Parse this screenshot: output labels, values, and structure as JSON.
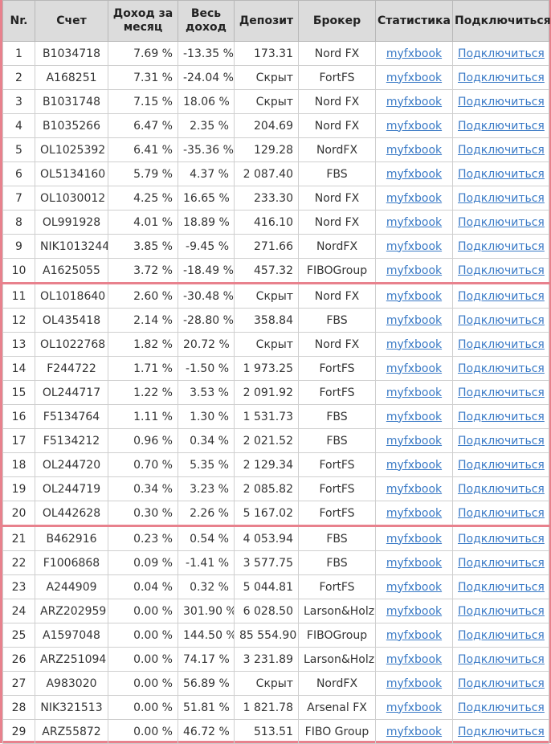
{
  "table": {
    "headers": [
      "Nr.",
      "Счет",
      "Доход за месяц",
      "Весь доход",
      "Депозит",
      "Брокер",
      "Статистика",
      "Подключиться"
    ],
    "stats_link_label": "myfxbook",
    "connect_link_label": "Подключиться",
    "rows": [
      {
        "nr": "1",
        "account": "B1034718",
        "monthly": "7.69 %",
        "total": "-13.35 %",
        "deposit": "173.31",
        "broker": "Nord FX"
      },
      {
        "nr": "2",
        "account": "A168251",
        "monthly": "7.31 %",
        "total": "-24.04 %",
        "deposit": "Скрыт",
        "broker": "FortFS"
      },
      {
        "nr": "3",
        "account": "B1031748",
        "monthly": "7.15 %",
        "total": "18.06 %",
        "deposit": "Скрыт",
        "broker": "Nord FX"
      },
      {
        "nr": "4",
        "account": "B1035266",
        "monthly": "6.47 %",
        "total": "2.35 %",
        "deposit": "204.69",
        "broker": "Nord FX"
      },
      {
        "nr": "5",
        "account": "OL1025392",
        "monthly": "6.41 %",
        "total": "-35.36 %",
        "deposit": "129.28",
        "broker": "NordFX"
      },
      {
        "nr": "6",
        "account": "OL5134160",
        "monthly": "5.79 %",
        "total": "4.37 %",
        "deposit": "2 087.40",
        "broker": "FBS"
      },
      {
        "nr": "7",
        "account": "OL1030012",
        "monthly": "4.25 %",
        "total": "16.65 %",
        "deposit": "233.30",
        "broker": "Nord FX"
      },
      {
        "nr": "8",
        "account": "OL991928",
        "monthly": "4.01 %",
        "total": "18.89 %",
        "deposit": "416.10",
        "broker": "Nord FX"
      },
      {
        "nr": "9",
        "account": "NIK1013244",
        "monthly": "3.85 %",
        "total": "-9.45 %",
        "deposit": "271.66",
        "broker": "NordFX"
      },
      {
        "nr": "10",
        "account": "A1625055",
        "monthly": "3.72 %",
        "total": "-18.49 %",
        "deposit": "457.32",
        "broker": "FIBOGroup"
      },
      {
        "nr": "11",
        "account": "OL1018640",
        "monthly": "2.60 %",
        "total": "-30.48 %",
        "deposit": "Скрыт",
        "broker": "Nord FX"
      },
      {
        "nr": "12",
        "account": "OL435418",
        "monthly": "2.14 %",
        "total": "-28.80 %",
        "deposit": "358.84",
        "broker": "FBS"
      },
      {
        "nr": "13",
        "account": "OL1022768",
        "monthly": "1.82 %",
        "total": "20.72 %",
        "deposit": "Скрыт",
        "broker": "Nord FX"
      },
      {
        "nr": "14",
        "account": "F244722",
        "monthly": "1.71 %",
        "total": "-1.50 %",
        "deposit": "1 973.25",
        "broker": "FortFS"
      },
      {
        "nr": "15",
        "account": "OL244717",
        "monthly": "1.22 %",
        "total": "3.53 %",
        "deposit": "2 091.92",
        "broker": "FortFS"
      },
      {
        "nr": "16",
        "account": "F5134764",
        "monthly": "1.11 %",
        "total": "1.30 %",
        "deposit": "1 531.73",
        "broker": "FBS"
      },
      {
        "nr": "17",
        "account": "F5134212",
        "monthly": "0.96 %",
        "total": "0.34 %",
        "deposit": "2 021.52",
        "broker": "FBS"
      },
      {
        "nr": "18",
        "account": "OL244720",
        "monthly": "0.70 %",
        "total": "5.35 %",
        "deposit": "2 129.34",
        "broker": "FortFS"
      },
      {
        "nr": "19",
        "account": "OL244719",
        "monthly": "0.34 %",
        "total": "3.23 %",
        "deposit": "2 085.82",
        "broker": "FortFS"
      },
      {
        "nr": "20",
        "account": "OL442628",
        "monthly": "0.30 %",
        "total": "2.26 %",
        "deposit": "5 167.02",
        "broker": "FortFS"
      },
      {
        "nr": "21",
        "account": "B462916",
        "monthly": "0.23 %",
        "total": "0.54 %",
        "deposit": "4 053.94",
        "broker": "FBS"
      },
      {
        "nr": "22",
        "account": "F1006868",
        "monthly": "0.09 %",
        "total": "-1.41 %",
        "deposit": "3 577.75",
        "broker": "FBS"
      },
      {
        "nr": "23",
        "account": "A244909",
        "monthly": "0.04 %",
        "total": "0.32 %",
        "deposit": "5 044.81",
        "broker": "FortFS"
      },
      {
        "nr": "24",
        "account": "ARZ202959",
        "monthly": "0.00 %",
        "total": "301.90 %",
        "deposit": "6 028.50",
        "broker": "Larson&Holz"
      },
      {
        "nr": "25",
        "account": "A1597048",
        "monthly": "0.00 %",
        "total": "144.50 %",
        "deposit": "85 554.90",
        "broker": "FIBOGroup"
      },
      {
        "nr": "26",
        "account": "ARZ251094",
        "monthly": "0.00 %",
        "total": "74.17 %",
        "deposit": "3 231.89",
        "broker": "Larson&Holz"
      },
      {
        "nr": "27",
        "account": "A983020",
        "monthly": "0.00 %",
        "total": "56.89 %",
        "deposit": "Скрыт",
        "broker": "NordFX"
      },
      {
        "nr": "28",
        "account": "NIK321513",
        "monthly": "0.00 %",
        "total": "51.81 %",
        "deposit": "1 821.78",
        "broker": "Arsenal FX"
      },
      {
        "nr": "29",
        "account": "ARZ55872",
        "monthly": "0.00 %",
        "total": "46.72 %",
        "deposit": "513.51",
        "broker": "FIBO Group"
      }
    ]
  }
}
